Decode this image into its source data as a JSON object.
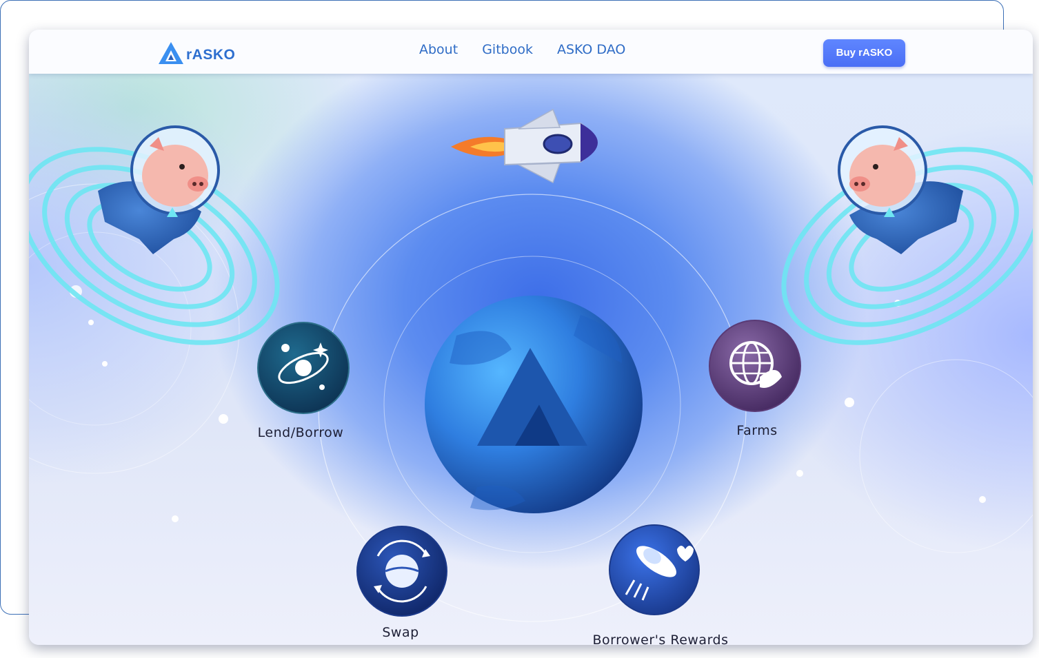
{
  "brand": {
    "name": "rASKO",
    "logo_icon": "asko-triangle-logo-icon"
  },
  "nav": {
    "links": [
      {
        "label": "About"
      },
      {
        "label": "Gitbook"
      },
      {
        "label": "ASKO DAO"
      }
    ],
    "cta_label": "Buy rASKO"
  },
  "services": [
    {
      "label": "Lend/Borrow",
      "icon": "galaxy-icon"
    },
    {
      "label": "Farms",
      "icon": "globe-leaf-icon"
    },
    {
      "label": "Swap",
      "icon": "planet-swap-icon"
    },
    {
      "label": "Borrower's Rewards",
      "icon": "ufo-icon"
    }
  ],
  "colors": {
    "accent": "#2e6fcf",
    "button": "#4a6ef5",
    "label_text": "#1d1f35"
  }
}
